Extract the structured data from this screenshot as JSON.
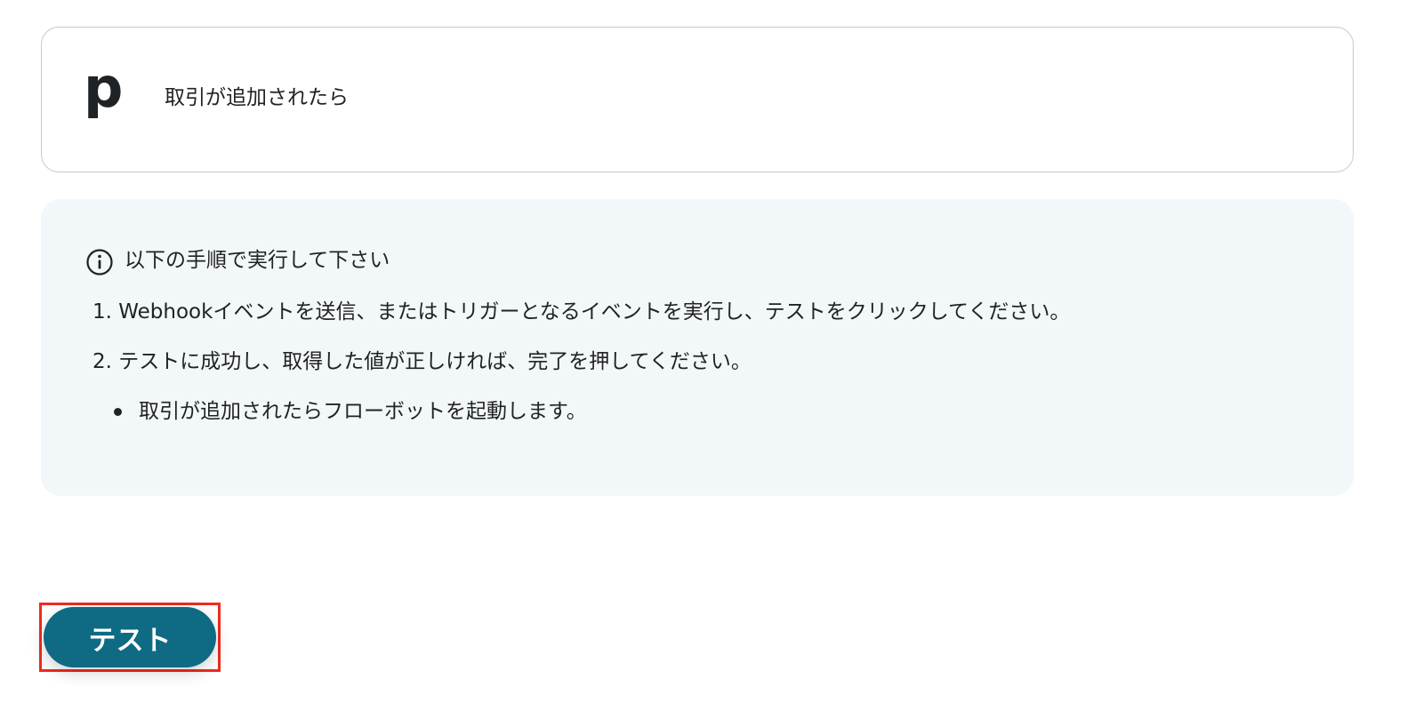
{
  "trigger": {
    "app_logo_letter": "p",
    "title": "取引が追加されたら"
  },
  "instructions": {
    "title": "以下の手順で実行して下さい",
    "steps": [
      "1. Webhookイベントを送信、またはトリガーとなるイベントを実行し、テストをクリックしてください。",
      "2. テストに成功し、取得した値が正しければ、完了を押してください。"
    ],
    "bullets": [
      "取引が追加されたらフローボットを起動します。"
    ]
  },
  "actions": {
    "test_label": "テスト"
  },
  "colors": {
    "primary_button": "#0f6a84",
    "panel_background": "#f2f8f9",
    "highlight": "#ee2b1e"
  },
  "icons": {
    "logo": "pipedrive-logo-icon",
    "info": "info-circle-icon"
  }
}
